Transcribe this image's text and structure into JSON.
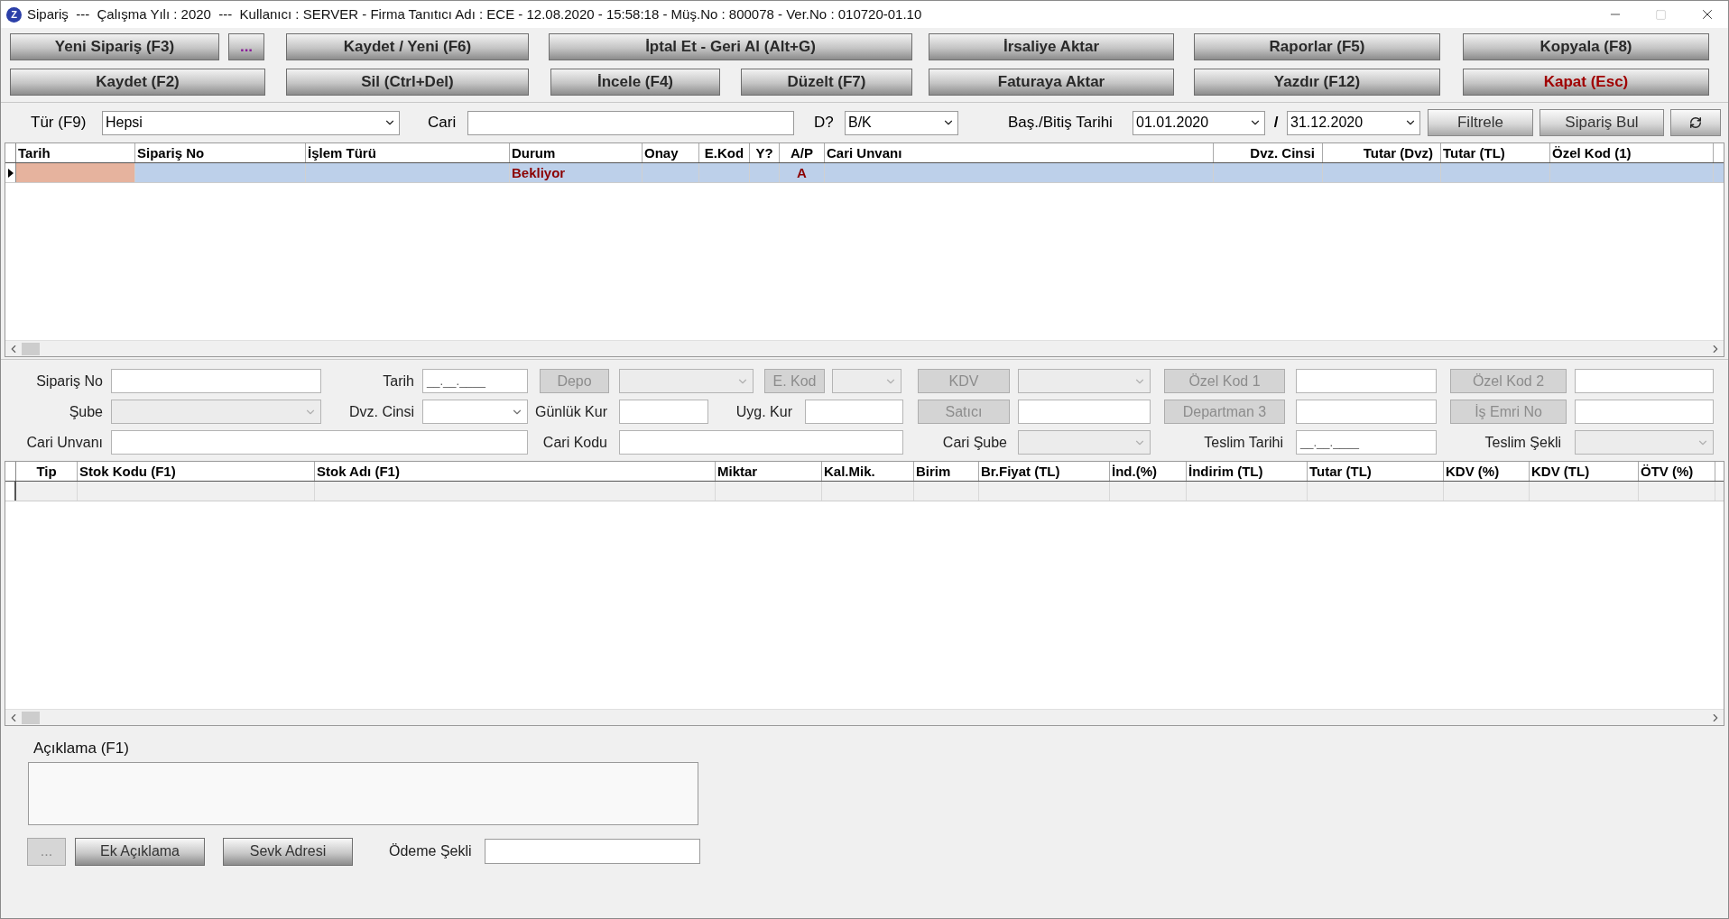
{
  "title_bar": {
    "icon_letter": "Z",
    "title": "Sipariş  ---  Çalışma Yılı : 2020  ---  Kullanıcı : SERVER - Firma Tanıtıcı Adı : ECE - 12.08.2020 - 15:58:18 - Müş.No : 800078 - Ver.No : 010720-01.10"
  },
  "toolbar": [
    [
      {
        "label": "Yeni Sipariş (F3)",
        "kind": "action"
      },
      {
        "label": "...",
        "kind": "more"
      },
      {
        "label": "Kaydet / Yeni (F6)",
        "kind": "action"
      },
      {
        "label": "İptal Et - Geri Al (Alt+G)",
        "kind": "action"
      },
      {
        "label": "İrsaliye Aktar",
        "kind": "action"
      },
      {
        "label": "Raporlar (F5)",
        "kind": "action"
      },
      {
        "label": "Kopyala (F8)",
        "kind": "action"
      }
    ],
    [
      {
        "label": "Kaydet (F2)",
        "kind": "action"
      },
      {
        "label": "Sil (Ctrl+Del)",
        "kind": "action"
      },
      {
        "label": "İncele (F4)",
        "kind": "action"
      },
      {
        "label": "Düzelt (F7)",
        "kind": "action"
      },
      {
        "label": "Faturaya Aktar",
        "kind": "action"
      },
      {
        "label": "Yazdır (F12)",
        "kind": "action"
      },
      {
        "label": "Kapat (Esc)",
        "kind": "close"
      }
    ]
  ],
  "filter": {
    "type": {
      "label": "Tür (F9)",
      "value": "Hepsi"
    },
    "cari": {
      "label": "Cari"
    },
    "d": {
      "label": "D?",
      "value": "B/K"
    },
    "dates": {
      "label": "Baş./Bitiş Tarihi",
      "start": "01.01.2020",
      "separator": "/",
      "end": "31.12.2020"
    },
    "buttons": [
      "Filtrele",
      "Sipariş Bul"
    ]
  },
  "orders": {
    "columns": [
      "Tarih",
      "Sipariş No",
      "İşlem Türü",
      "Durum",
      "Onay",
      "E.Kod",
      "Y?",
      "A/P",
      "Cari Unvanı",
      "Dvz. Cinsi",
      "Tutar (Dvz)",
      "Tutar (TL)",
      "Özel Kod (1)"
    ],
    "rows": [
      {
        "selected": true,
        "cells": [
          {
            "focused": true
          },
          {
            "focused": false
          },
          {
            "focused": false
          },
          {
            "text": "Bekliyor",
            "focused": false
          },
          {
            "focused": false
          },
          {
            "focused": false
          },
          {
            "focused": false
          },
          {
            "text": "A",
            "focused": false
          },
          {
            "focused": false
          },
          {
            "focused": false
          },
          {
            "focused": false
          },
          {
            "focused": false
          },
          {
            "focused": false
          }
        ]
      }
    ]
  },
  "form": [
    [
      {
        "kind": "label",
        "text": "Sipariş No"
      },
      {
        "kind": "input"
      },
      {
        "kind": "label",
        "text": "Tarih"
      },
      {
        "kind": "input",
        "value": "__.__.____"
      },
      {
        "kind": "button",
        "text": "Depo",
        "disabled": true
      },
      {
        "kind": "select",
        "disabled": true
      },
      {
        "kind": "button",
        "text": "E. Kod",
        "disabled": true
      },
      {
        "kind": "select",
        "disabled": true
      },
      {
        "kind": "button",
        "text": "KDV",
        "disabled": true
      },
      {
        "kind": "select",
        "disabled": true
      },
      {
        "kind": "button",
        "text": "Özel Kod 1",
        "disabled": true
      },
      {
        "kind": "input"
      },
      {
        "kind": "button",
        "text": "Özel Kod 2",
        "disabled": true
      },
      {
        "kind": "input"
      }
    ],
    [
      {
        "kind": "label",
        "text": "Şube"
      },
      {
        "kind": "select",
        "disabled": true
      },
      {
        "kind": "label",
        "text": "Dvz. Cinsi"
      },
      {
        "kind": "select",
        "disabled": false
      },
      {
        "kind": "label",
        "text": "Günlük Kur"
      },
      {
        "kind": "input"
      },
      {
        "kind": "label",
        "text": "Uyg. Kur"
      },
      {
        "kind": "input"
      },
      {
        "kind": "button",
        "text": "Satıcı",
        "disabled": true
      },
      {
        "kind": "input"
      },
      {
        "kind": "button",
        "text": "Departman 3",
        "disabled": true
      },
      {
        "kind": "input"
      },
      {
        "kind": "button",
        "text": "İş Emri No",
        "disabled": true
      },
      {
        "kind": "input"
      }
    ],
    [
      {
        "kind": "label",
        "text": "Cari Unvanı"
      },
      {
        "kind": "input"
      },
      {
        "kind": "label",
        "text": "Cari Kodu"
      },
      {
        "kind": "input"
      },
      {
        "kind": "label",
        "text": "Cari Şube"
      },
      {
        "kind": "select",
        "disabled": true
      },
      {
        "kind": "label",
        "text": "Teslim Tarihi"
      },
      {
        "kind": "input",
        "value": "__.__.____"
      },
      {
        "kind": "label",
        "text": "Teslim Şekli"
      },
      {
        "kind": "select",
        "disabled": true
      }
    ]
  ],
  "items": {
    "columns": [
      "Tip",
      "Stok Kodu (F1)",
      "Stok Adı (F1)",
      "Miktar",
      "Kal.Mik.",
      "Birim",
      "Br.Fiyat (TL)",
      "İnd.(%)",
      "İndirim (TL)",
      "Tutar (TL)",
      "KDV (%)",
      "KDV (TL)",
      "ÖTV (%)"
    ]
  },
  "notes": {
    "label": "Açıklama (F1)"
  },
  "bottom": {
    "buttons": [
      {
        "label": "...",
        "disabled": true
      },
      {
        "label": "Ek Açıklama",
        "disabled": false
      },
      {
        "label": "Sevk Adresi",
        "disabled": false
      }
    ],
    "payment": {
      "label": "Ödeme Şekli"
    }
  }
}
